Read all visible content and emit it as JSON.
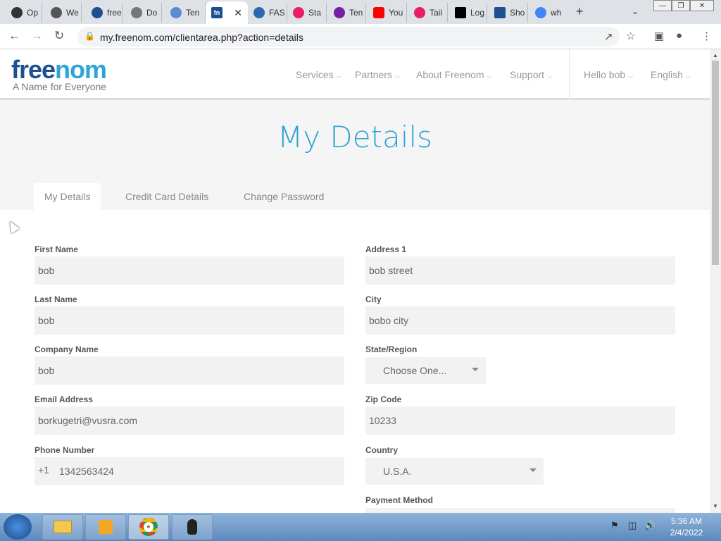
{
  "browser": {
    "tabs": [
      {
        "label": "Op",
        "color": "#333"
      },
      {
        "label": "We",
        "color": "#555"
      },
      {
        "label": "free",
        "color": "#1d4f91"
      },
      {
        "label": "Do",
        "color": "#777"
      },
      {
        "label": "Ten",
        "color": "#5b8bd0"
      },
      {
        "label": "",
        "color": "#1d4f91",
        "active": true
      },
      {
        "label": "FAS",
        "color": "#2a6ab0"
      },
      {
        "label": "Sta",
        "color": "#e91e63"
      },
      {
        "label": "Ten",
        "color": "#7b1fa2"
      },
      {
        "label": "You",
        "color": "#ff0000"
      },
      {
        "label": "Tail",
        "color": "#e91e63"
      },
      {
        "label": "Log",
        "color": "#000"
      },
      {
        "label": "Sho",
        "color": "#1d4f91"
      },
      {
        "label": "wh",
        "color": "#4285f4"
      }
    ],
    "active_tab_icon": "fn",
    "close_glyph": "✕",
    "new_tab_glyph": "+",
    "url": "my.freenom.com/clientarea.php?action=details"
  },
  "site": {
    "logo_main": "free",
    "logo_accent": "nom",
    "tagline": "A Name for Everyone",
    "nav": [
      "Services",
      "Partners",
      "About Freenom",
      "Support"
    ],
    "user_menu": "Hello bob",
    "language": "English"
  },
  "page": {
    "title": "My Details",
    "tabs": [
      "My Details",
      "Credit Card Details",
      "Change Password"
    ]
  },
  "form": {
    "first_name_label": "First Name",
    "first_name": "bob",
    "last_name_label": "Last Name",
    "last_name": "bob",
    "company_label": "Company Name",
    "company": "bob",
    "email_label": "Email Address",
    "email": "borkugetri@vusra.com",
    "phone_label": "Phone Number",
    "phone_prefix": "+1",
    "phone": "1342563424",
    "address1_label": "Address 1",
    "address1": "bob street",
    "city_label": "City",
    "city": "bobo city",
    "state_label": "State/Region",
    "state": "Choose One...",
    "zip_label": "Zip Code",
    "zip": "10233",
    "country_label": "Country",
    "country": "U.S.A.",
    "payment_label": "Payment Method"
  },
  "taskbar": {
    "time": "5:36 AM",
    "date": "2/4/2022"
  }
}
